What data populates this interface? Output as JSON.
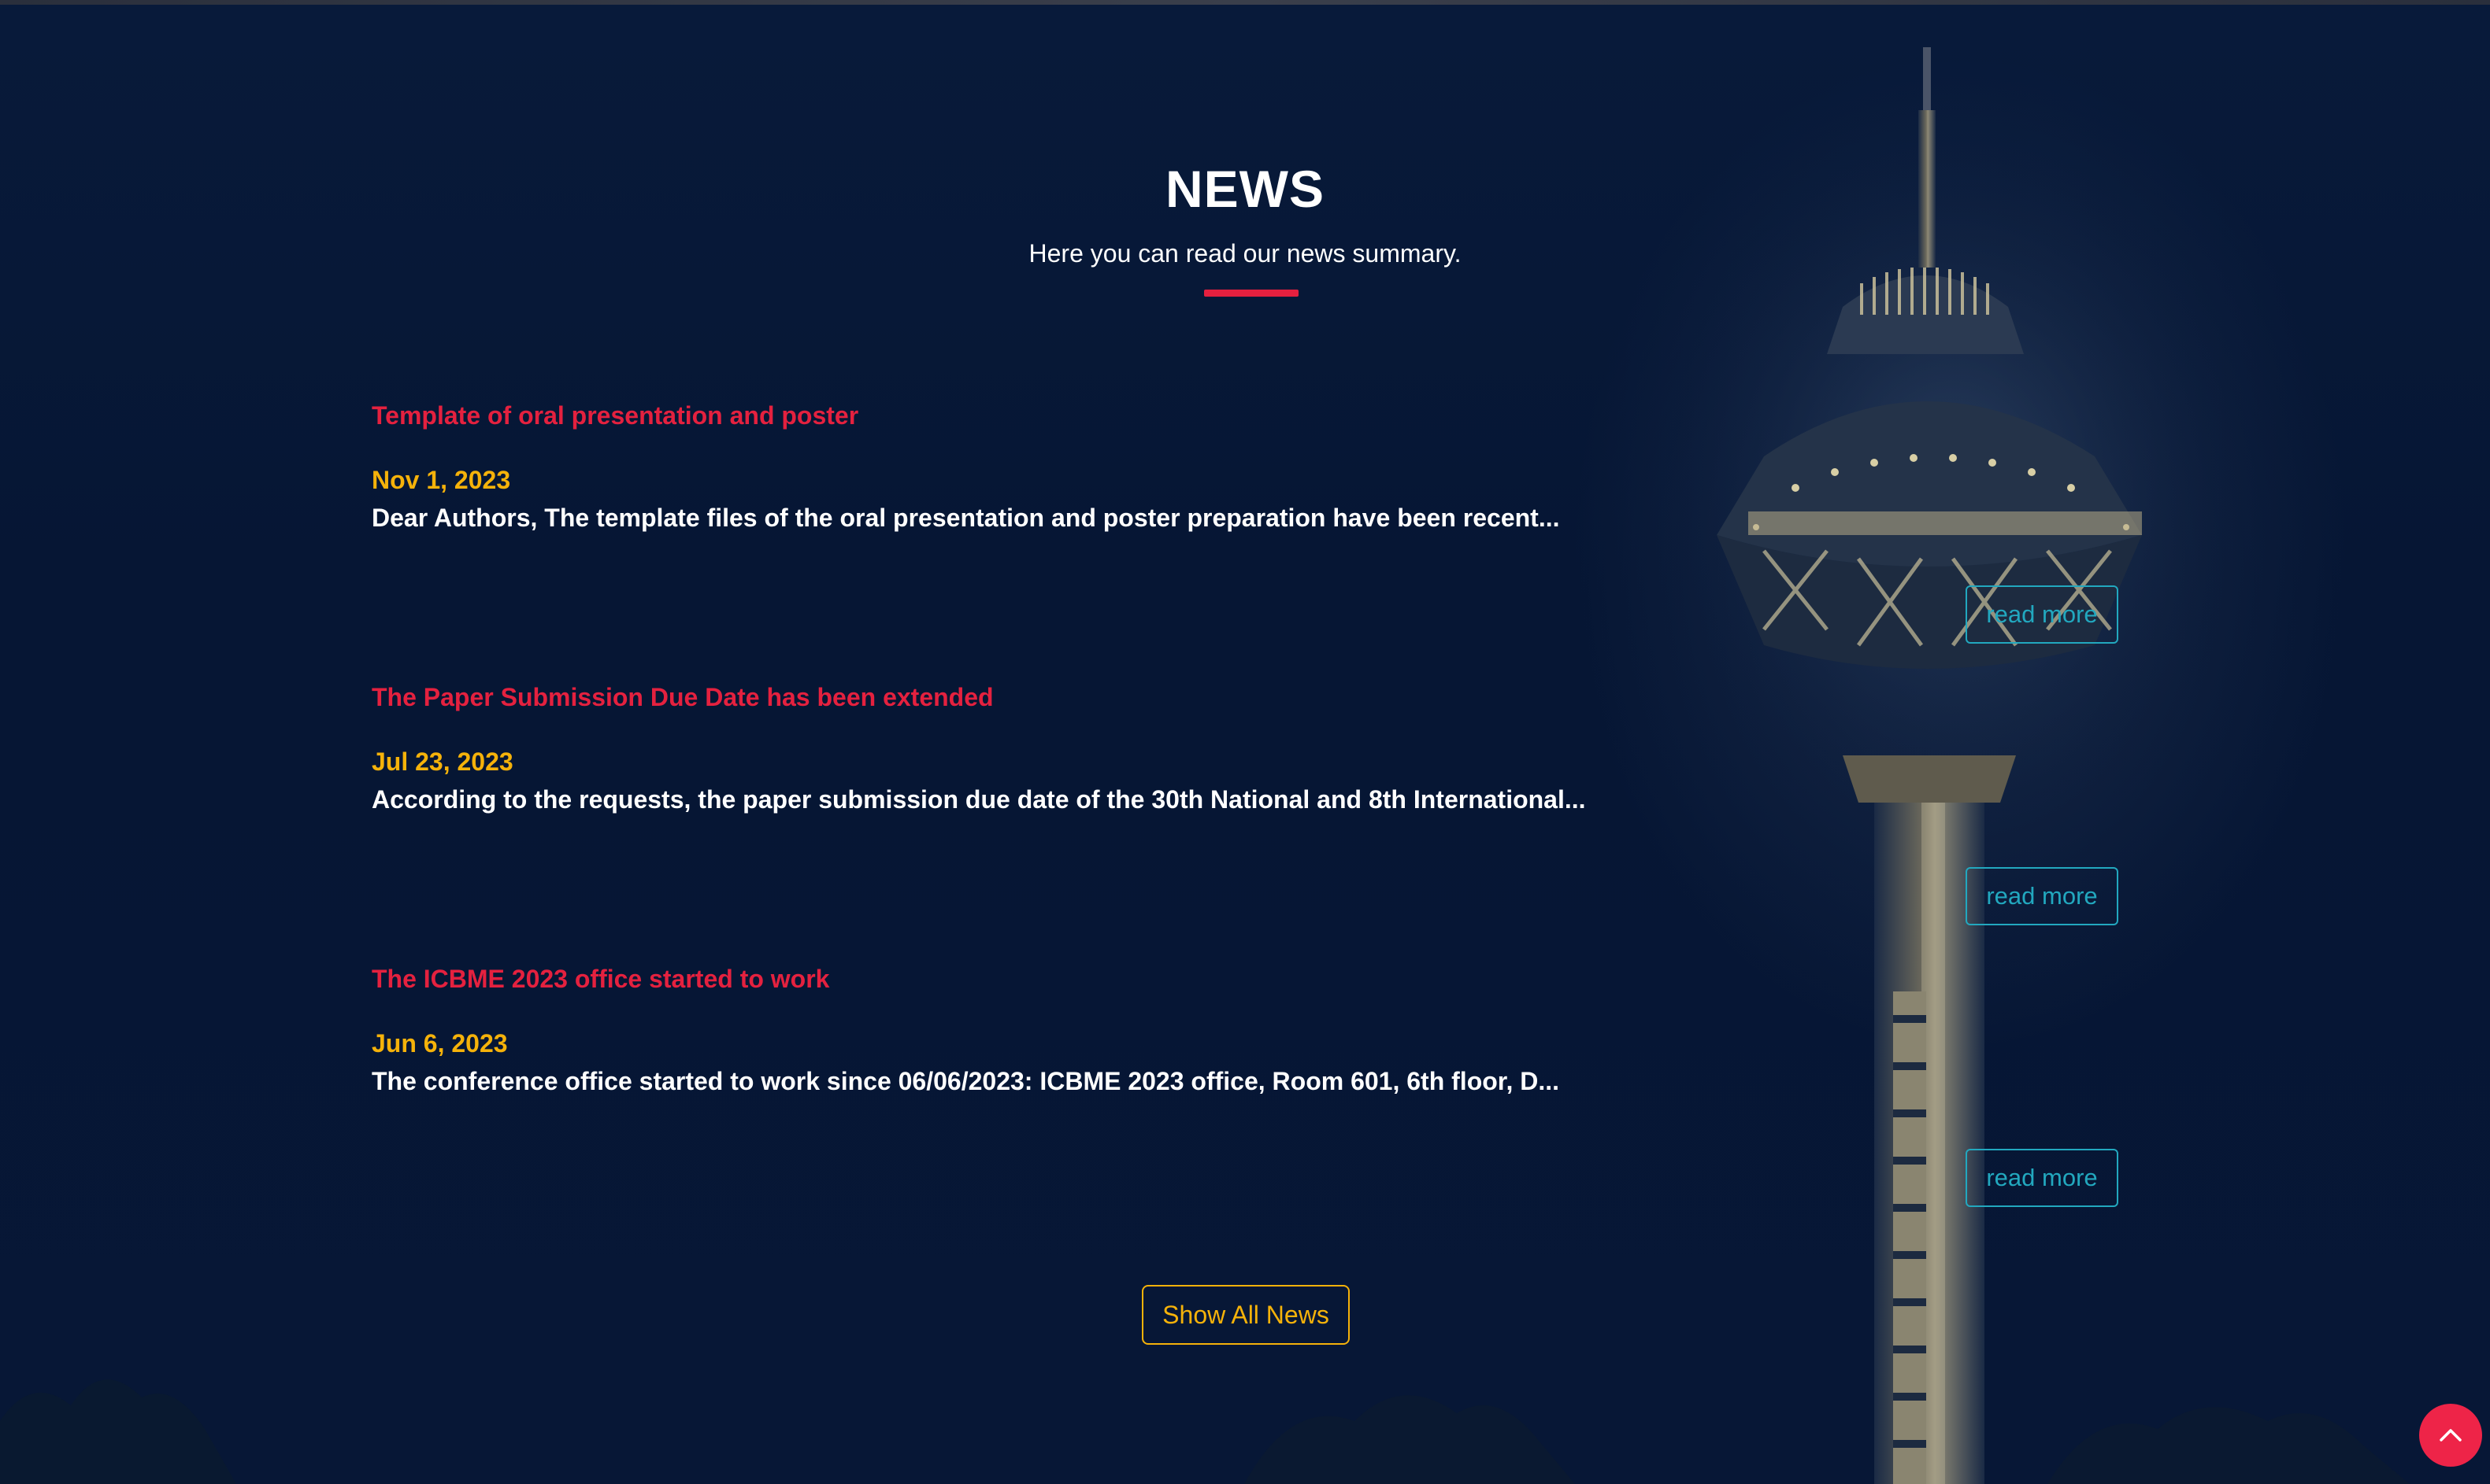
{
  "section": {
    "title": "NEWS",
    "subtitle": "Here you can read our news summary."
  },
  "news": [
    {
      "title": "Template of oral presentation and poster",
      "date": "Nov 1, 2023",
      "excerpt": "Dear Authors, The template files of the oral presentation and poster preparation have been recent...",
      "read_more": "read more"
    },
    {
      "title": "The Paper Submission Due Date has been extended",
      "date": "Jul 23, 2023",
      "excerpt": "According to the requests, the paper submission due date of the 30th National and 8th International...",
      "read_more": "read more"
    },
    {
      "title": "The ICBME 2023 office started to work",
      "date": "Jun 6, 2023",
      "excerpt": "The conference office started to work since 06/06/2023: ICBME 2023 office, Room 601, 6th floor, D...",
      "read_more": "read more"
    }
  ],
  "show_all_label": "Show All News",
  "icons": {
    "scroll_top": "chevron-up-icon"
  },
  "colors": {
    "background": "#061634",
    "accent_red": "#e4213f",
    "date_yellow": "#f5b20a",
    "read_more_teal": "#22a8bf",
    "scroll_button": "#ee2448"
  }
}
